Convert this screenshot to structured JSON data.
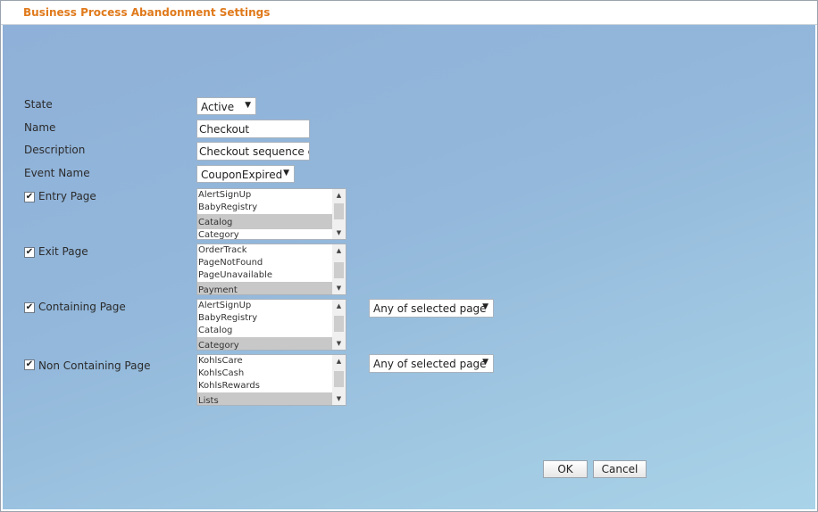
{
  "dialog": {
    "title": "Business Process Abandonment Settings"
  },
  "form": {
    "state": {
      "label": "State",
      "value": "Active"
    },
    "name": {
      "label": "Name",
      "value": "Checkout"
    },
    "description": {
      "label": "Description",
      "value": "Checkout sequence ex"
    },
    "event_name": {
      "label": "Event Name",
      "value": "CouponExpired"
    },
    "entry_page": {
      "label": "Entry Page",
      "checked": true,
      "items": [
        "AlertSignUp",
        "BabyRegistry",
        "Catalog",
        "Category"
      ],
      "selected": "Catalog"
    },
    "exit_page": {
      "label": "Exit Page",
      "checked": true,
      "items": [
        "OrderTrack",
        "PageNotFound",
        "PageUnavailable",
        "Payment"
      ],
      "selected": "Payment"
    },
    "containing_page": {
      "label": "Containing Page",
      "checked": true,
      "items": [
        "AlertSignUp",
        "BabyRegistry",
        "Catalog",
        "Category"
      ],
      "selected": "Category",
      "mode": "Any of selected page"
    },
    "non_containing_page": {
      "label": "Non Containing Page",
      "checked": true,
      "items": [
        "KohlsCare",
        "KohlsCash",
        "KohlsRewards",
        "Lists"
      ],
      "selected": "Lists",
      "mode": "Any of selected page"
    }
  },
  "buttons": {
    "ok": "OK",
    "cancel": "Cancel"
  },
  "icons": {
    "dropdown": "caret-down-icon",
    "check": "checkmark-icon",
    "scroll_up": "scroll-up-icon",
    "scroll_down": "scroll-down-icon"
  },
  "colors": {
    "title": "#e07a1c",
    "background_top": "#8fb0d8",
    "background_bottom": "#a9d3e8",
    "list_selected": "#c8c8c8"
  }
}
